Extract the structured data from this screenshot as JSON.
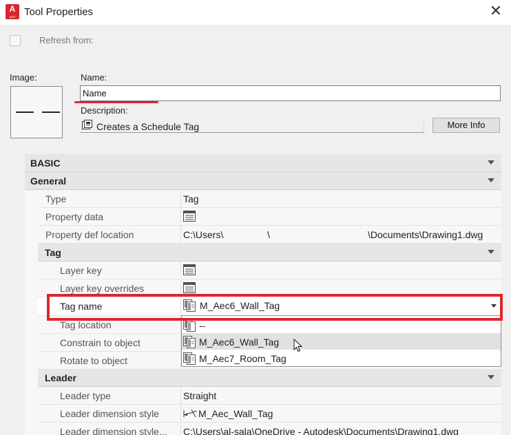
{
  "window": {
    "title": "Tool Properties",
    "app_icon_letter": "A",
    "app_icon_sub": "MEP",
    "close_glyph": "✕"
  },
  "refresh": {
    "label": "Refresh from:"
  },
  "image": {
    "label": "Image:"
  },
  "name": {
    "label": "Name:",
    "value": "Name"
  },
  "description": {
    "label": "Description:",
    "value": "Creates a Schedule Tag"
  },
  "more_info": {
    "label": "More Info"
  },
  "grid": {
    "basic": "BASIC",
    "general": "General",
    "type": {
      "name": "Type",
      "value": "Tag"
    },
    "property_data": {
      "name": "Property data"
    },
    "property_def_location": {
      "name": "Property def location",
      "value_a": "C:\\Users\\",
      "value_b": "\\",
      "value_c": "\\Documents\\Drawing1.dwg"
    },
    "tag": "Tag",
    "layer_key": {
      "name": "Layer key"
    },
    "layer_key_overrides": {
      "name": "Layer key overrides"
    },
    "tag_name": {
      "name": "Tag name",
      "value": "M_Aec6_Wall_Tag"
    },
    "tag_location": {
      "name": "Tag location"
    },
    "constrain_to_object": {
      "name": "Constrain to object"
    },
    "rotate_to_object": {
      "name": "Rotate to object"
    },
    "leader": "Leader",
    "leader_type": {
      "name": "Leader type",
      "value": "Straight"
    },
    "leader_dimension_style": {
      "name": "Leader dimension style",
      "value": "M_Aec_Wall_Tag"
    },
    "leader_dimension_style_2": {
      "name": "Leader dimension style...",
      "value": "C:\\Users\\al-sala\\OneDrive - Autodesk\\Documents\\Drawing1.dwg"
    }
  },
  "dropdown": {
    "options": [
      "--",
      "M_Aec6_Wall_Tag",
      "M_Aec7_Room_Tag"
    ],
    "selected": "M_Aec6_Wall_Tag"
  },
  "colors": {
    "annotation_red": "#e0242b",
    "app_icon_red": "#d7262e"
  }
}
